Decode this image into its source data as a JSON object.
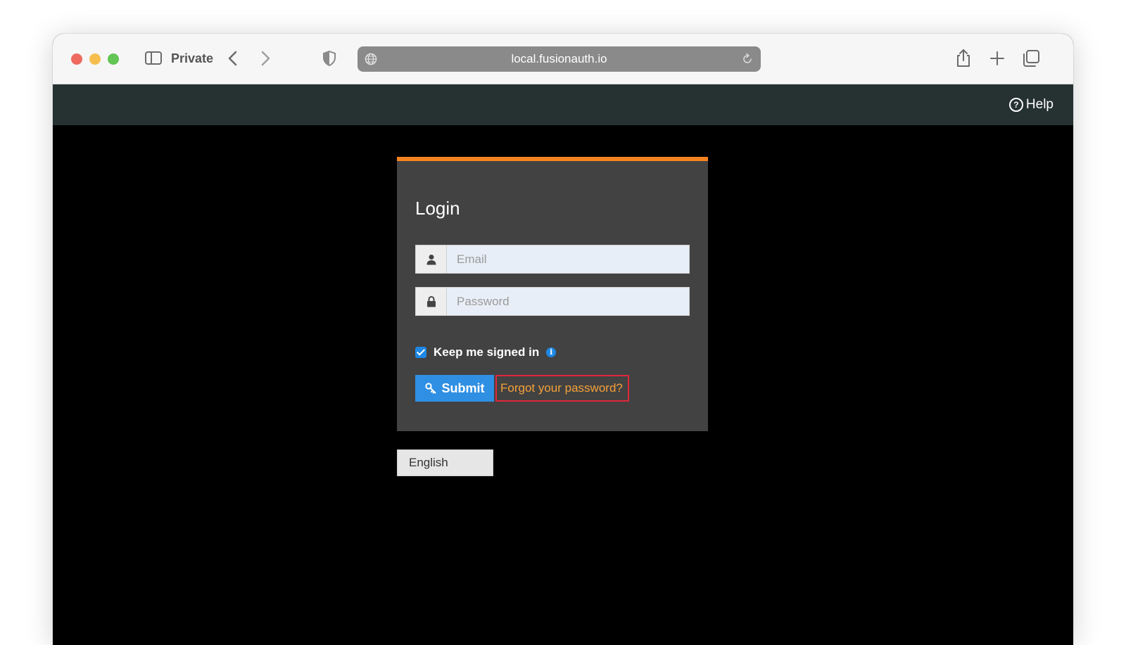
{
  "browser": {
    "private_label": "Private",
    "url": "local.fusionauth.io",
    "icons": {
      "sidebar": "sidebar-icon",
      "back": "chevron-left-icon",
      "forward": "chevron-right-icon",
      "shield": "shield-icon",
      "globe": "globe-icon",
      "reload": "reload-icon",
      "share": "share-icon",
      "new_tab": "plus-icon",
      "tabs": "tabs-overview-icon"
    }
  },
  "header": {
    "help_label": "Help",
    "help_icon_glyph": "?"
  },
  "login": {
    "title": "Login",
    "email_placeholder": "Email",
    "password_placeholder": "Password",
    "remember_label": "Keep me signed in",
    "remember_checked": true,
    "info_glyph": "i",
    "submit_label": "Submit",
    "forgot_label": "Forgot your password?"
  },
  "locale": {
    "selected": "English"
  },
  "colors": {
    "header_bg": "#263132",
    "panel_bg": "#424242",
    "panel_accent": "#f58320",
    "primary_button": "#2f8fe3",
    "link": "#f5a03a",
    "highlight_border": "#e0273a"
  }
}
